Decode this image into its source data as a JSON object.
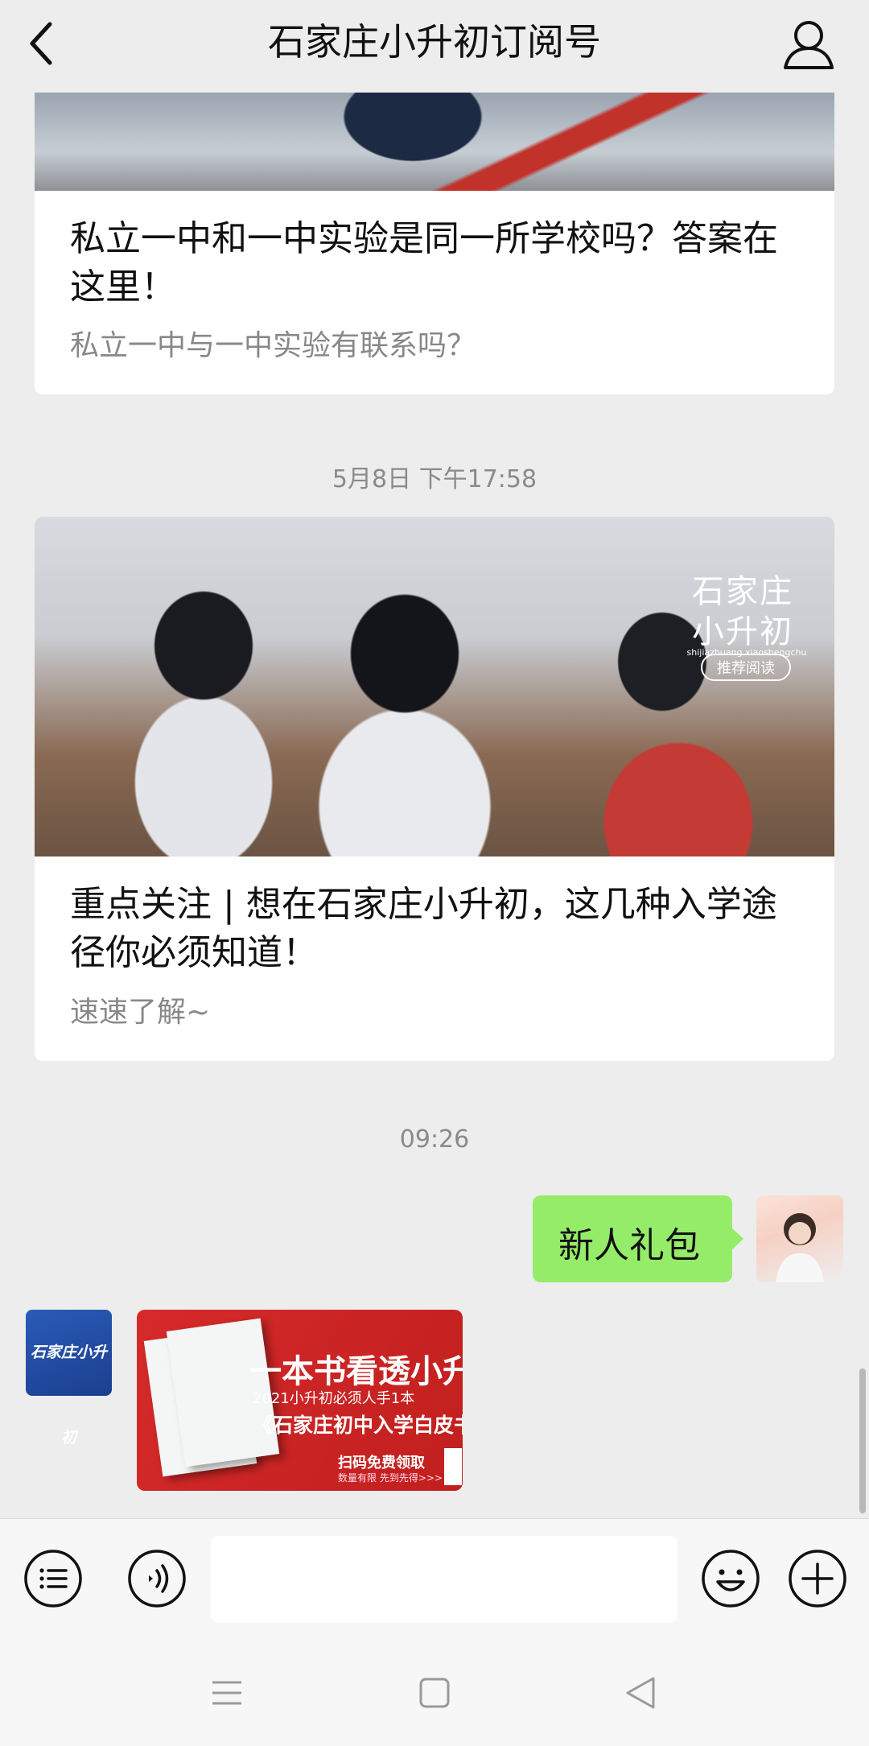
{
  "header": {
    "title": "石家庄小升初订阅号"
  },
  "articles": [
    {
      "title": "私立一中和一中实验是同一所学校吗？答案在这里！",
      "subtitle": "私立一中与一中实验有联系吗？"
    },
    {
      "title": "重点关注 | 想在石家庄小升初，这几种入学途径你必须知道！",
      "subtitle": "速速了解~"
    }
  ],
  "timestamps": [
    "5月8日 下午17:58",
    "09:26"
  ],
  "cover_overlay": {
    "line1": "石家庄",
    "line2": "小升初",
    "pinyin": "shijiazhuang xiaoshengchu",
    "tag": "推荐阅读"
  },
  "chat": {
    "my_message": "新人礼包",
    "biz_avatar_text": "石家庄小升初",
    "promo": {
      "title": "一本书看透小升初",
      "line1": "2021小升初必须人手1本",
      "line2": "《石家庄初中入学白皮书》最新版",
      "cta": "扫码免费领取",
      "cta_sub": "数量有限 先到先得>>>"
    }
  },
  "colors": {
    "bubble": "#95EC69",
    "background": "#EDEDED"
  }
}
